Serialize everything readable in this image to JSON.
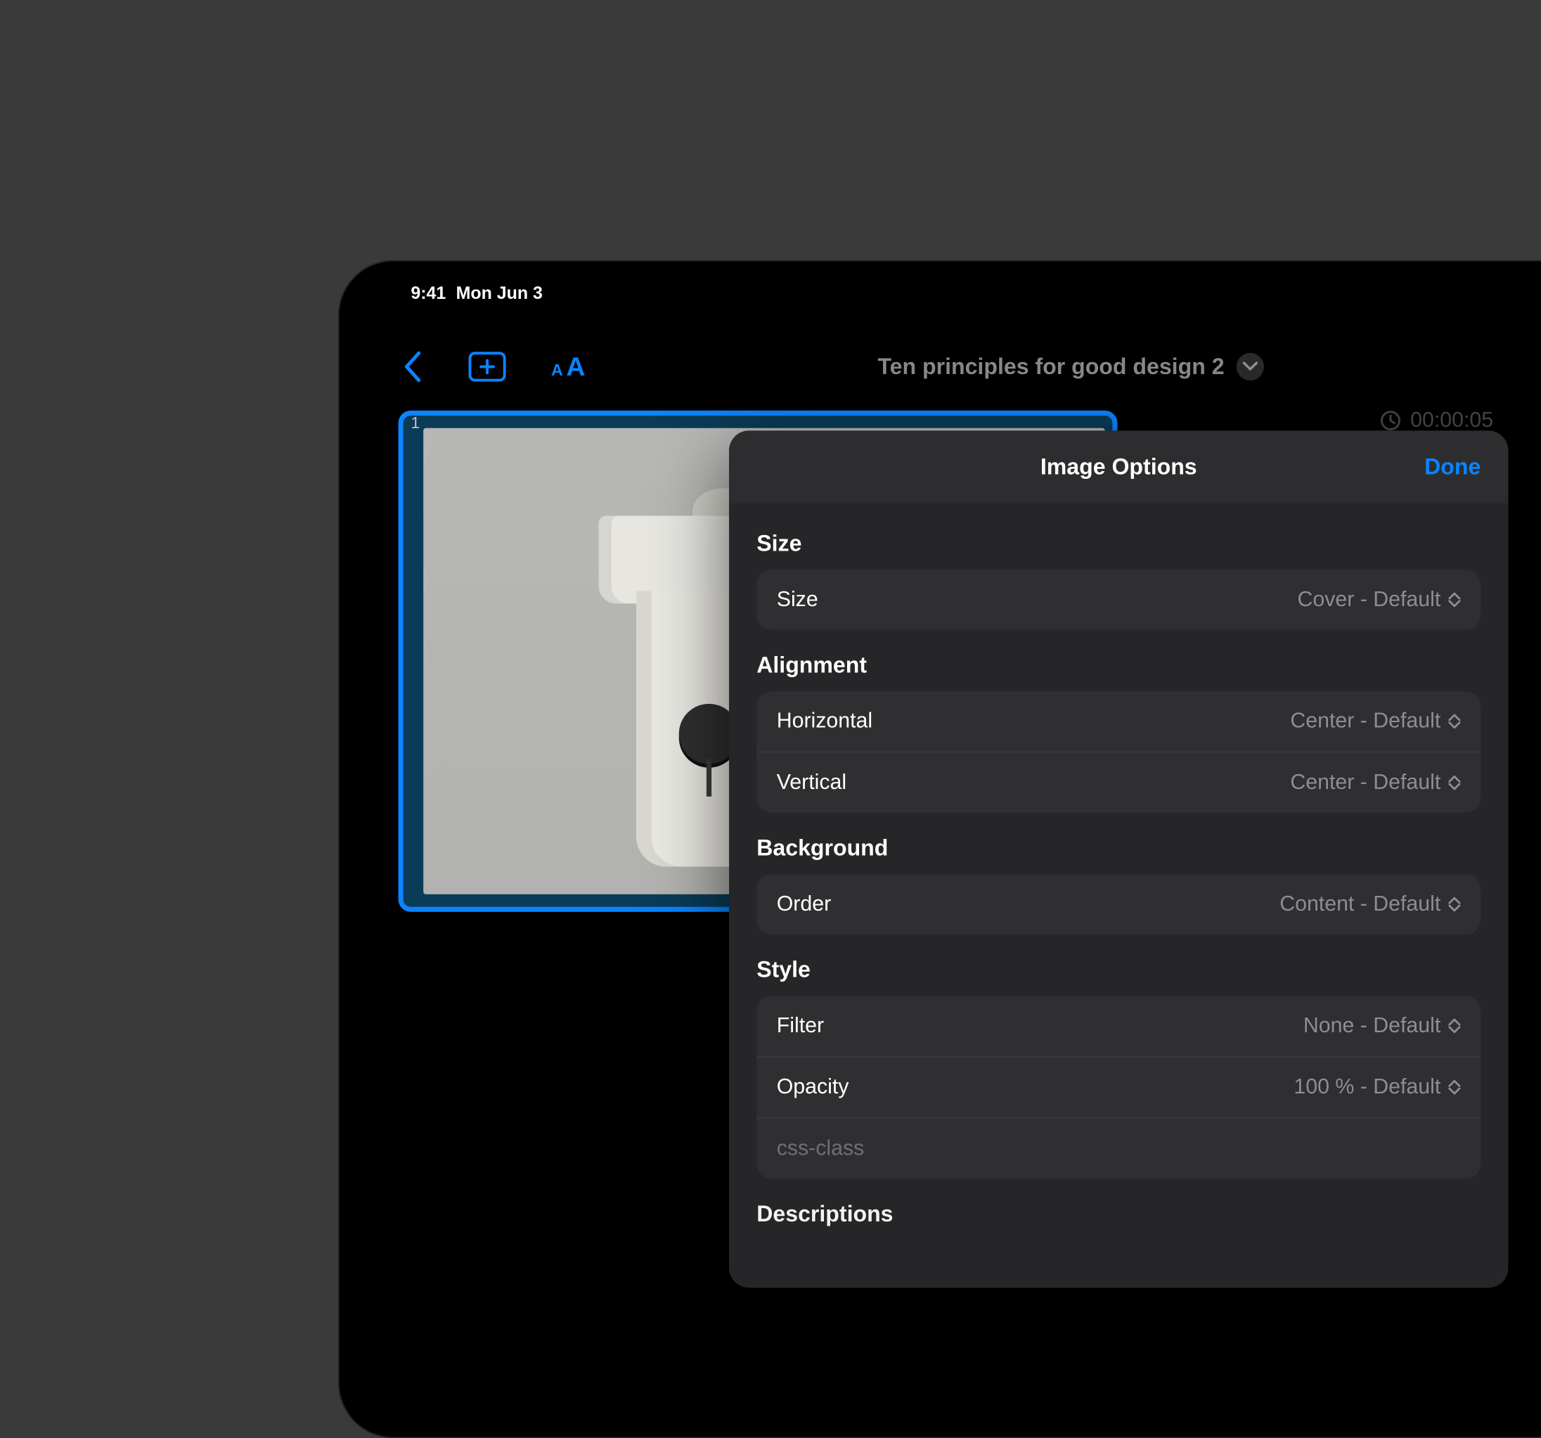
{
  "status": {
    "time": "9:41",
    "date": "Mon Jun 3"
  },
  "toolbar": {
    "title": "Ten principles for good design 2"
  },
  "slide": {
    "number": "1"
  },
  "timer": {
    "value": "00:00:05"
  },
  "modal": {
    "title": "Image Options",
    "done": "Done",
    "sections": {
      "size": {
        "title": "Size",
        "rows": {
          "size": {
            "label": "Size",
            "value": "Cover - Default"
          }
        }
      },
      "alignment": {
        "title": "Alignment",
        "rows": {
          "horizontal": {
            "label": "Horizontal",
            "value": "Center - Default"
          },
          "vertical": {
            "label": "Vertical",
            "value": "Center - Default"
          }
        }
      },
      "background": {
        "title": "Background",
        "rows": {
          "order": {
            "label": "Order",
            "value": "Content - Default"
          }
        }
      },
      "style": {
        "title": "Style",
        "rows": {
          "filter": {
            "label": "Filter",
            "value": "None - Default"
          },
          "opacity": {
            "label": "Opacity",
            "value": "100 % - Default"
          },
          "cssclass": {
            "placeholder": "css-class"
          }
        }
      },
      "descriptions": {
        "title": "Descriptions"
      }
    }
  }
}
